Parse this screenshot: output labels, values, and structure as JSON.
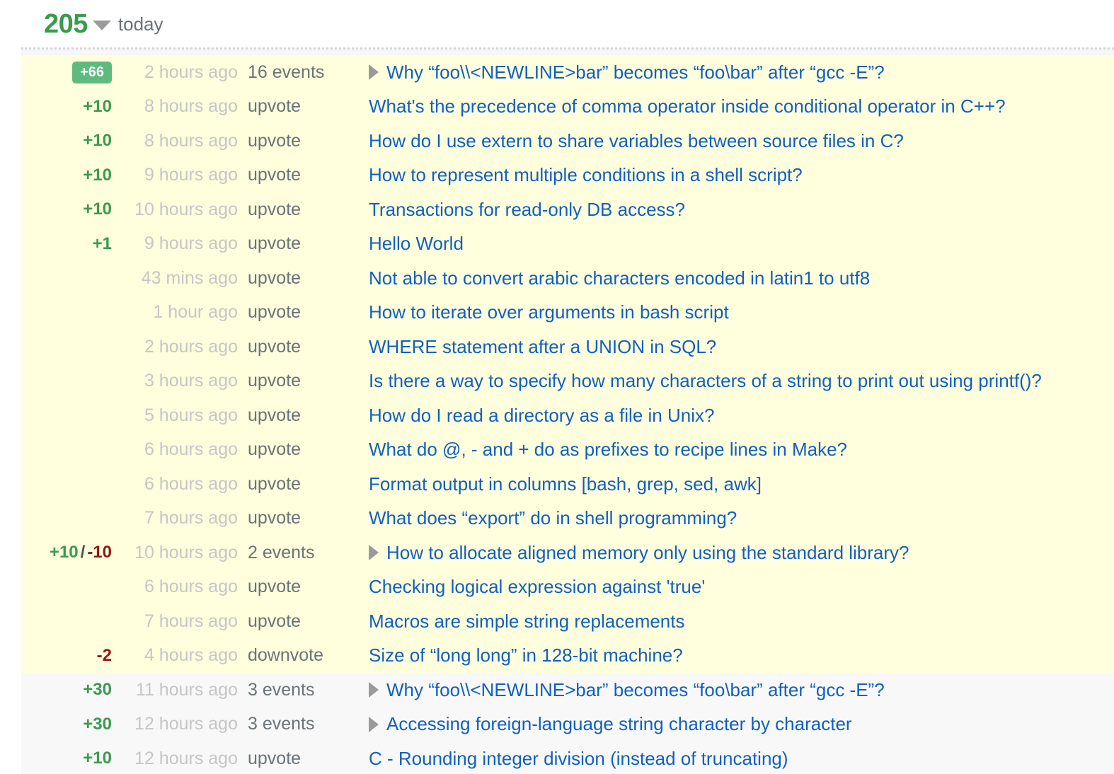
{
  "header": {
    "total": "205",
    "caret_icon": "chevron-down-icon",
    "period": "today"
  },
  "colors": {
    "positive": "#3a9b4e",
    "negative": "#8b1a15",
    "badge_bg": "#5eba7d",
    "link": "#1060c0",
    "today_row_bg": "#ffffdd",
    "previous_row_bg": "#f8f8f8",
    "muted_date": "#c6c6c6",
    "kind_text": "#6a7377"
  },
  "table": {
    "rows": [
      {
        "score": "+66",
        "score_kind": "badge",
        "date": "2 hours ago",
        "kind": "16 events",
        "expandable": true,
        "title": "Why “foo\\\\<NEWLINE>bar” becomes “foo\\bar” after “gcc -E”?",
        "group": "today"
      },
      {
        "score": "+10",
        "score_kind": "positive",
        "date": "8 hours ago",
        "kind": "upvote",
        "expandable": false,
        "title": "What's the precedence of comma operator inside conditional operator in C++?",
        "group": "today"
      },
      {
        "score": "+10",
        "score_kind": "positive",
        "date": "8 hours ago",
        "kind": "upvote",
        "expandable": false,
        "title": "How do I use extern to share variables between source files in C?",
        "group": "today"
      },
      {
        "score": "+10",
        "score_kind": "positive",
        "date": "9 hours ago",
        "kind": "upvote",
        "expandable": false,
        "title": "How to represent multiple conditions in a shell script?",
        "group": "today"
      },
      {
        "score": "+10",
        "score_kind": "positive",
        "date": "10 hours ago",
        "kind": "upvote",
        "expandable": false,
        "title": "Transactions for read-only DB access?",
        "group": "today"
      },
      {
        "score": "+1",
        "score_kind": "positive",
        "date": "9 hours ago",
        "kind": "upvote",
        "expandable": false,
        "title": "Hello World",
        "group": "today"
      },
      {
        "score": "",
        "score_kind": "none",
        "date": "43 mins ago",
        "kind": "upvote",
        "expandable": false,
        "title": "Not able to convert arabic characters encoded in latin1 to utf8",
        "group": "today"
      },
      {
        "score": "",
        "score_kind": "none",
        "date": "1 hour ago",
        "kind": "upvote",
        "expandable": false,
        "title": "How to iterate over arguments in bash script",
        "group": "today"
      },
      {
        "score": "",
        "score_kind": "none",
        "date": "2 hours ago",
        "kind": "upvote",
        "expandable": false,
        "title": "WHERE statement after a UNION in SQL?",
        "group": "today"
      },
      {
        "score": "",
        "score_kind": "none",
        "date": "3 hours ago",
        "kind": "upvote",
        "expandable": false,
        "title": "Is there a way to specify how many characters of a string to print out using printf()?",
        "group": "today"
      },
      {
        "score": "",
        "score_kind": "none",
        "date": "5 hours ago",
        "kind": "upvote",
        "expandable": false,
        "title": "How do I read a directory as a file in Unix?",
        "group": "today"
      },
      {
        "score": "",
        "score_kind": "none",
        "date": "6 hours ago",
        "kind": "upvote",
        "expandable": false,
        "title": "What do @, - and + do as prefixes to recipe lines in Make?",
        "group": "today"
      },
      {
        "score": "",
        "score_kind": "none",
        "date": "6 hours ago",
        "kind": "upvote",
        "expandable": false,
        "title": "Format output in columns [bash, grep, sed, awk]",
        "group": "today"
      },
      {
        "score": "",
        "score_kind": "none",
        "date": "7 hours ago",
        "kind": "upvote",
        "expandable": false,
        "title": "What does “export” do in shell programming?",
        "group": "today"
      },
      {
        "score_pos": "+10",
        "score_sep": "/",
        "score_neg": "-10",
        "score_kind": "split",
        "date": "10 hours ago",
        "kind": "2 events",
        "expandable": true,
        "title": "How to allocate aligned memory only using the standard library?",
        "group": "today"
      },
      {
        "score": "",
        "score_kind": "none",
        "date": "6 hours ago",
        "kind": "upvote",
        "expandable": false,
        "title": "Checking logical expression against 'true'",
        "group": "today"
      },
      {
        "score": "",
        "score_kind": "none",
        "date": "7 hours ago",
        "kind": "upvote",
        "expandable": false,
        "title": "Macros are simple string replacements",
        "group": "today"
      },
      {
        "score": "-2",
        "score_kind": "negative",
        "date": "4 hours ago",
        "kind": "downvote",
        "expandable": false,
        "title": "Size of “long long” in 128-bit machine?",
        "group": "today"
      },
      {
        "score": "+30",
        "score_kind": "positive",
        "date": "11 hours ago",
        "kind": "3 events",
        "expandable": true,
        "title": "Why “foo\\\\<NEWLINE>bar” becomes “foo\\bar” after “gcc -E”?",
        "group": "previous"
      },
      {
        "score": "+30",
        "score_kind": "positive",
        "date": "12 hours ago",
        "kind": "3 events",
        "expandable": true,
        "title": "Accessing foreign-language string character by character",
        "group": "previous"
      },
      {
        "score": "+10",
        "score_kind": "positive",
        "date": "12 hours ago",
        "kind": "upvote",
        "expandable": false,
        "title": "C - Rounding integer division (instead of truncating)",
        "group": "previous"
      }
    ]
  }
}
